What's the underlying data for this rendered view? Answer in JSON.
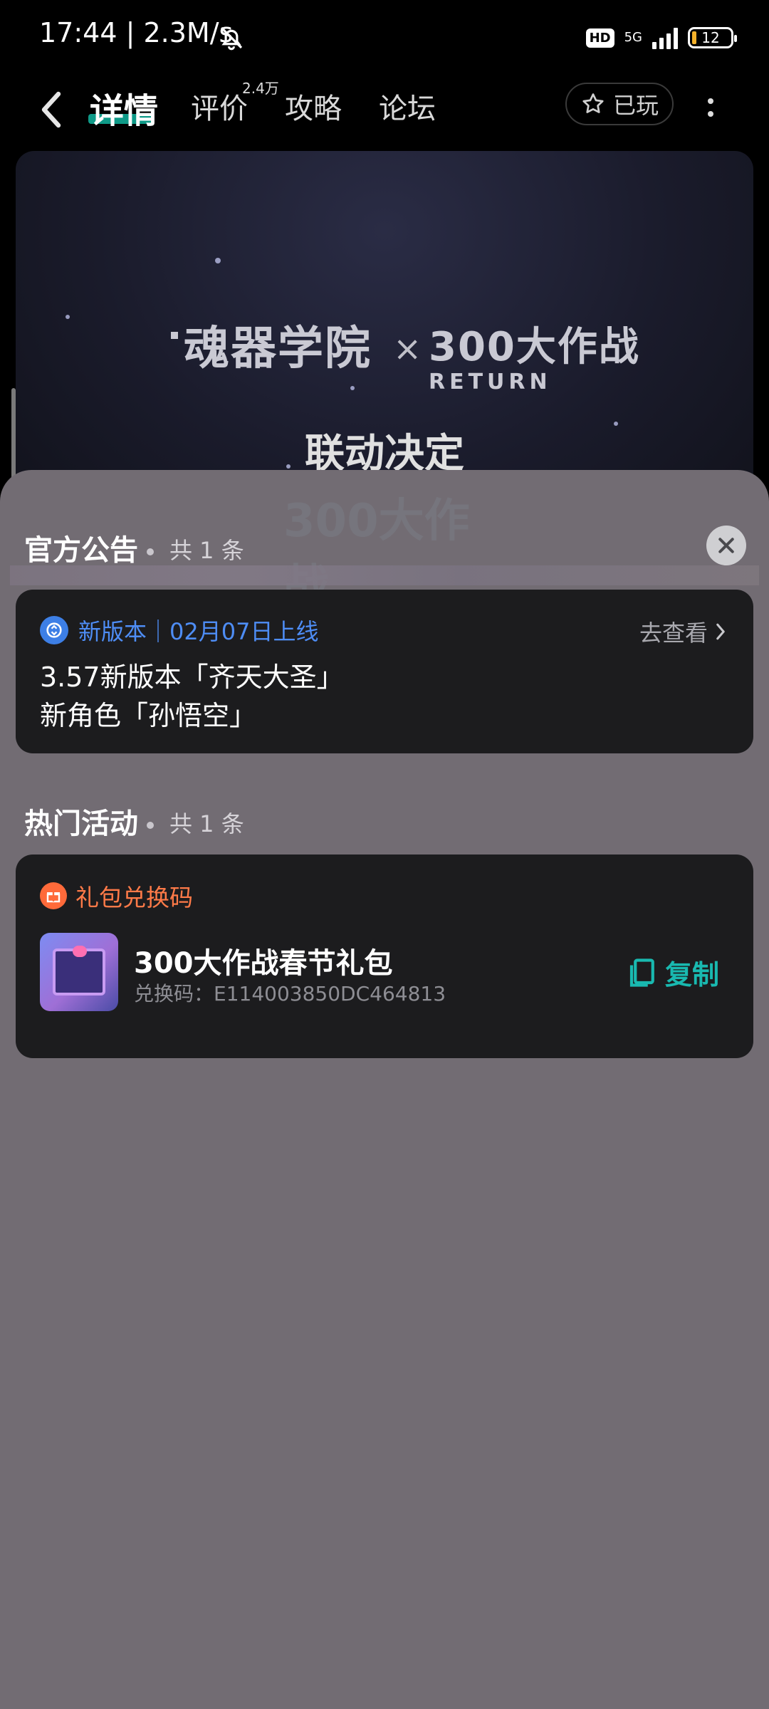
{
  "status_bar": {
    "time": "17:44 | 2.3M/s",
    "hd": "HD",
    "network": "5G",
    "battery": "12"
  },
  "nav": {
    "tabs": [
      {
        "label": "详情"
      },
      {
        "label": "评价",
        "badge": "2.4万"
      },
      {
        "label": "攻略"
      },
      {
        "label": "论坛"
      }
    ],
    "played_label": "已玩"
  },
  "banner": {
    "logo_left": "魂器学院",
    "cross": "×",
    "logo_right": "300大作战",
    "logo_right_sub": "RETURN",
    "headline": "联动决定"
  },
  "notices": {
    "title": "官方公告",
    "meta": "共 1 条",
    "item": {
      "tag": "新版本｜02月07日上线",
      "link": "去查看",
      "line1": "3.57新版本「齐天大圣」",
      "line2": "新角色「孙悟空」"
    }
  },
  "activities": {
    "title": "热门活动",
    "meta": "共 1 条",
    "card": {
      "tag": "礼包兑换码",
      "name": "300大作战春节礼包",
      "code": "兑换码：E114003850DC464813",
      "copy": "复制"
    }
  },
  "colors": {
    "accent": "#19b9b0",
    "notice_blue": "#4e8df5",
    "gift_orange": "#ff7a48",
    "sheet": "#726c73"
  }
}
